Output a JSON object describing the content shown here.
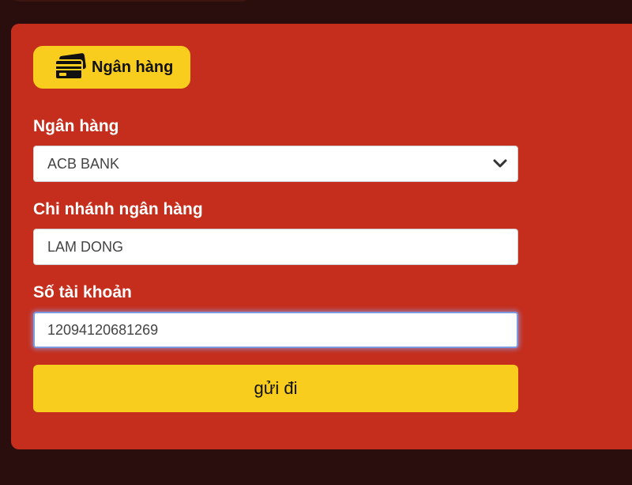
{
  "section": {
    "badge_label": "Ngân hàng",
    "badge_icon": "bank-card-icon"
  },
  "form": {
    "bank": {
      "label": "Ngân hàng",
      "value": "ACB BANK",
      "icon": "chevron-down-icon"
    },
    "branch": {
      "label": "Chi nhánh ngân hàng",
      "value": "LAM DONG"
    },
    "account": {
      "label": "Số tài khoản",
      "value": "12094120681269"
    },
    "submit_label": "gửi đi"
  },
  "colors": {
    "background": "#2a0e0d",
    "panel": "#c52e1c",
    "accent": "#f8cd1e",
    "focus_ring": "#7c9ae0"
  }
}
